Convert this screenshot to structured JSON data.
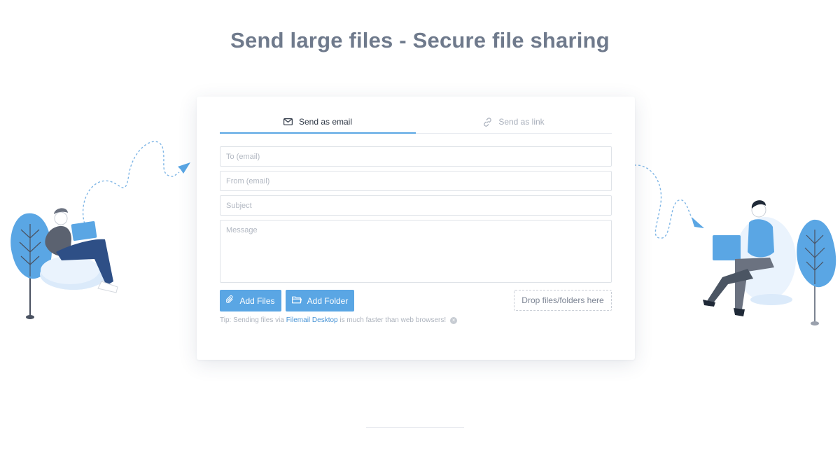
{
  "page": {
    "title": "Send large files - Secure file sharing"
  },
  "tabs": [
    {
      "label": "Send as email",
      "icon": "envelope-icon",
      "active": true
    },
    {
      "label": "Send as link",
      "icon": "link-icon",
      "active": false
    }
  ],
  "form": {
    "to": {
      "placeholder": "To (email)",
      "value": ""
    },
    "from": {
      "placeholder": "From (email)",
      "value": ""
    },
    "subject": {
      "placeholder": "Subject",
      "value": ""
    },
    "message": {
      "placeholder": "Message",
      "value": ""
    }
  },
  "actions": {
    "add_files": {
      "label": "Add Files",
      "icon": "paperclip-icon"
    },
    "add_folder": {
      "label": "Add Folder",
      "icon": "folder-icon"
    },
    "drop_zone": "Drop files/folders here"
  },
  "tip": {
    "prefix": "Tip: Sending files via ",
    "link": "Filemail Desktop",
    "suffix": " is much faster than web browsers!",
    "close_icon": "close-icon"
  },
  "colors": {
    "accent": "#5aa6e4",
    "title": "#6f7a8c",
    "navy": "#2e4f86"
  }
}
